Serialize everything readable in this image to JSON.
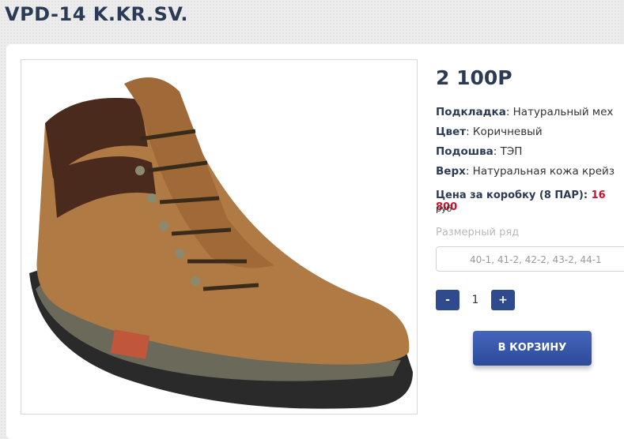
{
  "product": {
    "title": "VPD-14 K.KR.SV.",
    "price": "2 100Р",
    "specs": [
      {
        "label": "Подкладка",
        "value": ": Натуральный мех"
      },
      {
        "label": "Цвет",
        "value": ": Коричневый"
      },
      {
        "label": "Подошва",
        "value": ": ТЭП"
      },
      {
        "label": "Верх",
        "value": ": Натуральная кожа крейз"
      }
    ],
    "box_price_label": "Цена за коробку (8 ПАР): ",
    "box_price_value": "16 800",
    "box_price_unit": "руб",
    "size_label": "Размерный ряд",
    "size_value": "40-1, 41-2, 42-2, 43-2, 44-1",
    "image_icon": "boot-photo"
  },
  "cart": {
    "minus_label": "-",
    "quantity": "1",
    "plus_label": "+",
    "add_label": "В КОРЗИНУ"
  },
  "colors": {
    "accent": "#2f4a8d",
    "price_red": "#c8102e",
    "title": "#2b3a55"
  }
}
